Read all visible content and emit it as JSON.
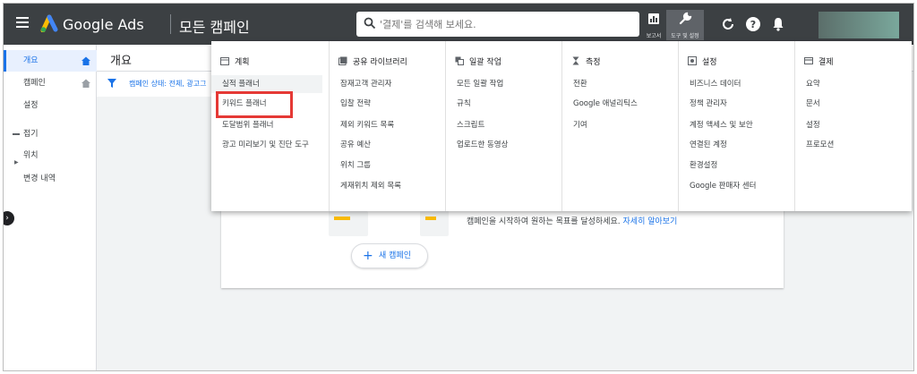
{
  "topbar": {
    "brand": "Google Ads",
    "page_title": "모든 캠페인",
    "search_placeholder": "'결제'를 검색해 보세요.",
    "reports_label": "보고서",
    "tools_label": "도구 및 설정",
    "icons": [
      "menu-icon",
      "google-ads-logo",
      "search-icon",
      "reports-icon",
      "wrench-icon",
      "refresh-icon",
      "help-icon",
      "bell-icon"
    ]
  },
  "sidebar": {
    "items": [
      {
        "label": "개요"
      },
      {
        "label": "캠페인"
      },
      {
        "label": "설정"
      },
      {
        "label": "접기"
      },
      {
        "label": "위치"
      },
      {
        "label": "변경 내역"
      }
    ]
  },
  "main": {
    "title": "개요",
    "filter_text": "캠페인 상태: 전체, 광고그",
    "card_text": "캠페인을 시작하여 원하는 목표를 달성하세요.",
    "card_link": "자세히 알아보기",
    "new_campaign": "새 캠페인"
  },
  "menu": {
    "columns": [
      {
        "heading": "계획",
        "icon": "calendar-icon",
        "items": [
          "실적 플래너",
          "키워드 플래너",
          "도달범위 플래너",
          "광고 미리보기 및 진단 도구"
        ]
      },
      {
        "heading": "공유 라이브러리",
        "icon": "library-icon",
        "items": [
          "잠재고객 관리자",
          "입찰 전략",
          "제외 키워드 목록",
          "공유 예산",
          "위치 그룹",
          "게재위치 제외 목록"
        ]
      },
      {
        "heading": "일괄 작업",
        "icon": "bulk-icon",
        "items": [
          "모든 일괄 작업",
          "규칙",
          "스크립트",
          "업로드한 동영상"
        ]
      },
      {
        "heading": "측정",
        "icon": "hourglass-icon",
        "items": [
          "전환",
          "Google 애널리틱스",
          "기여"
        ]
      },
      {
        "heading": "설정",
        "icon": "settings-icon",
        "items": [
          "비즈니스 데이터",
          "정책 관리자",
          "계정 액세스 및 보안",
          "연결된 계정",
          "환경설정",
          "Google 판매자 센터"
        ]
      },
      {
        "heading": "결제",
        "icon": "card-icon",
        "items": [
          "요약",
          "문서",
          "설정",
          "프로모션"
        ]
      }
    ],
    "highlighted_item": "키워드 플래너",
    "highlight_color": "#e53935"
  }
}
